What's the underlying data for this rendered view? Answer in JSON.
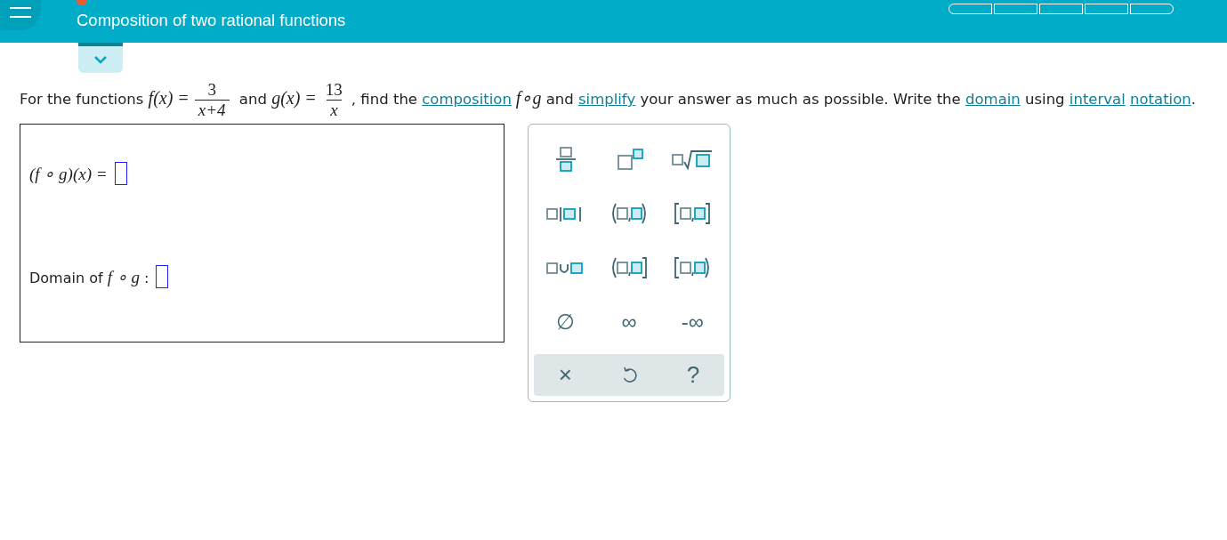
{
  "header": {
    "title": "Composition of two rational functions",
    "progress": [
      {
        "filled": false
      },
      {
        "filled": false
      },
      {
        "filled": false
      },
      {
        "filled": false
      },
      {
        "filled": false
      }
    ]
  },
  "question": [
    {
      "kind": "text",
      "text": "For the functions "
    },
    {
      "kind": "math",
      "text": "f(x) ="
    },
    {
      "kind": "fraction",
      "num": "3",
      "den": "x+4"
    },
    {
      "kind": "text",
      "text": " and "
    },
    {
      "kind": "math",
      "text": "g(x) ="
    },
    {
      "kind": "fraction",
      "num": "13",
      "den": "x"
    },
    {
      "kind": "text",
      "text": ", find the "
    },
    {
      "kind": "link",
      "text": "composition"
    },
    {
      "kind": "math",
      "text": " f∘g"
    },
    {
      "kind": "text",
      "text": " and "
    },
    {
      "kind": "link",
      "text": "simplify"
    },
    {
      "kind": "text",
      "text": " your answer as much as possible. Write the "
    },
    {
      "kind": "link",
      "text": "domain"
    },
    {
      "kind": "text",
      "text": " using "
    },
    {
      "kind": "link",
      "text": "interval"
    },
    {
      "kind": "link",
      "text": "notation"
    },
    {
      "kind": "text",
      "text": "."
    }
  ],
  "answers": [
    {
      "kind": "math",
      "label": "(f ∘ g)(x) ="
    },
    {
      "kind": "text",
      "label": "Domain of",
      "math": "f ∘ g",
      "suffix": ":"
    }
  ],
  "keypad": {
    "keys": [
      {
        "kind": "fraction"
      },
      {
        "kind": "power"
      },
      {
        "kind": "root"
      },
      {
        "kind": "abs"
      },
      {
        "kind": "open-open"
      },
      {
        "kind": "closed-closed"
      },
      {
        "kind": "union"
      },
      {
        "kind": "open-closed"
      },
      {
        "kind": "closed-open"
      },
      {
        "kind": "symbol",
        "label": "∅"
      },
      {
        "kind": "symbol",
        "label": "∞"
      },
      {
        "kind": "symbol",
        "label": "-∞"
      }
    ],
    "actions": [
      {
        "kind": "clear",
        "label": "×"
      },
      {
        "kind": "undo"
      },
      {
        "kind": "help",
        "label": "?"
      }
    ]
  }
}
